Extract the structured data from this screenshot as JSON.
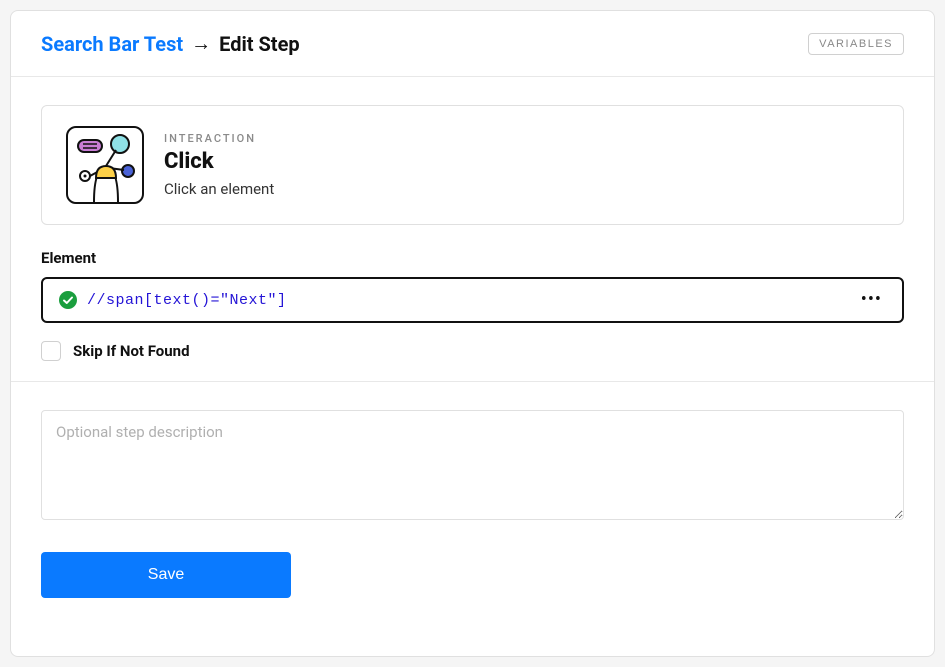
{
  "header": {
    "breadcrumb_link": "Search Bar Test",
    "breadcrumb_arrow": "→",
    "breadcrumb_current": "Edit Step",
    "variables_label": "VARIABLES"
  },
  "interaction": {
    "category_label": "INTERACTION",
    "title": "Click",
    "description": "Click an element"
  },
  "element": {
    "label": "Element",
    "value": "//span[text()=\"Next\"]",
    "more": "•••"
  },
  "skip": {
    "label": "Skip If Not Found"
  },
  "description": {
    "placeholder": "Optional step description",
    "value": ""
  },
  "actions": {
    "save_label": "Save"
  }
}
